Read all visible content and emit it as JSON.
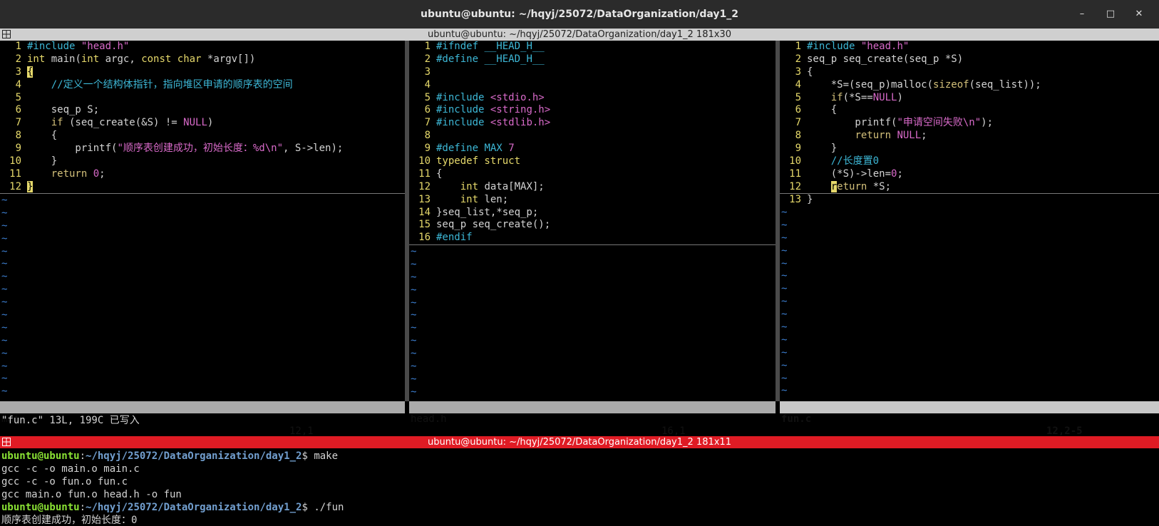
{
  "window": {
    "title": "ubuntu@ubuntu: ~/hqyj/25072/DataOrganization/day1_2"
  },
  "pane_top": {
    "title": "ubuntu@ubuntu: ~/hqyj/25072/DataOrganization/day1_2 181x30"
  },
  "pane_bottom": {
    "title": "ubuntu@ubuntu: ~/hqyj/25072/DataOrganization/day1_2 181x11"
  },
  "editors": [
    {
      "file": "main.c",
      "pos": "12,1",
      "scroll": "全部",
      "lines": [
        "#include \"head.h\"",
        "int main(int argc, const char *argv[])",
        "{",
        "    //定义一个结构体指针，指向堆区申请的顺序表的空间",
        "",
        "    seq_p S;",
        "    if (seq_create(&S) != NULL)",
        "    {",
        "        printf(\"顺序表创建成功，初始长度：%d\\n\", S->len);",
        "    }",
        "    return 0;",
        "}"
      ]
    },
    {
      "file": "head.h",
      "pos": "16,1",
      "scroll": "全部",
      "lines": [
        "#ifndef __HEAD_H__",
        "#define __HEAD_H__",
        "",
        "",
        "#include <stdio.h>",
        "#include <string.h>",
        "#include <stdlib.h>",
        "",
        "#define MAX 7",
        "typedef struct",
        "{",
        "    int data[MAX];",
        "    int len;",
        "}seq_list,*seq_p;",
        "seq_p seq_create();",
        "#endif"
      ]
    },
    {
      "file": "fun.c",
      "pos": "12,2-5",
      "scroll": "全部",
      "lines": [
        "#include \"head.h\"",
        "seq_p seq_create(seq_p *S)",
        "{",
        "    *S=(seq_p)malloc(sizeof(seq_list));",
        "    if(*S==NULL)",
        "    {",
        "        printf(\"申请空间失败\\n\");",
        "        return NULL;",
        "    }",
        "    //长度置0",
        "    (*S)->len=0;",
        "    return *S;",
        "}"
      ]
    }
  ],
  "vim_message": "\"fun.c\" 13L, 199C 已写入",
  "terminal": {
    "prompt_user": "ubuntu@ubuntu",
    "prompt_path": "~/hqyj/25072/DataOrganization/day1_2",
    "lines": [
      {
        "type": "prompt",
        "cmd": "make"
      },
      {
        "type": "out",
        "text": "gcc -c -o main.o main.c"
      },
      {
        "type": "out",
        "text": "gcc -c -o fun.o fun.c"
      },
      {
        "type": "out",
        "text": "gcc main.o fun.o head.h -o fun"
      },
      {
        "type": "prompt",
        "cmd": "./fun"
      },
      {
        "type": "out",
        "text": "顺序表创建成功，初始长度：0"
      }
    ]
  },
  "icons": {
    "pane": "terminal-grid-icon",
    "minimize": "minimize-icon",
    "maximize": "maximize-icon",
    "close": "close-icon"
  }
}
